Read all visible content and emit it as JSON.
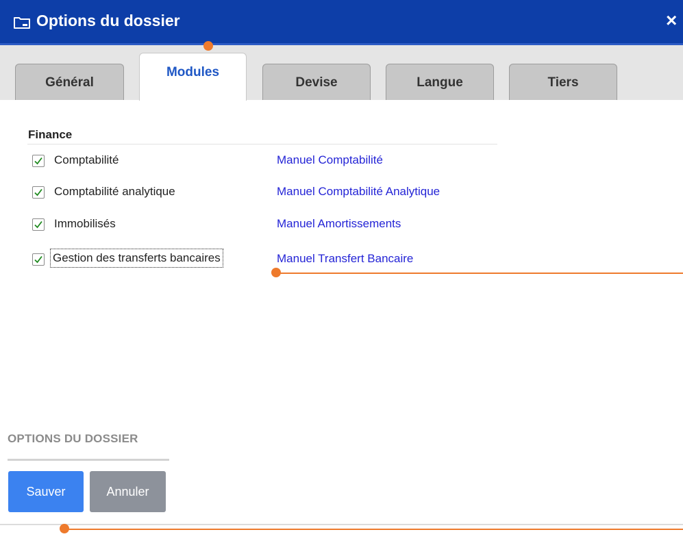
{
  "dialog": {
    "title": "Options du dossier",
    "title_icon": "folder-icon",
    "close_label": "×",
    "colors": {
      "titlebar": "#0d3ea8",
      "active_tab_text": "#1f57c5",
      "link": "#2424d6",
      "save_button": "#3b82f0",
      "cancel_button": "#8d929b",
      "annotation": "#ee7a2c"
    }
  },
  "tabs": [
    {
      "label": "Général",
      "active": false
    },
    {
      "label": "Modules",
      "active": true
    },
    {
      "label": "Devise",
      "active": false
    },
    {
      "label": "Langue",
      "active": false
    },
    {
      "label": "Tiers",
      "active": false
    }
  ],
  "section": {
    "title": "Finance",
    "modules": [
      {
        "label": "Comptabilité",
        "checked": true,
        "manual": "Manuel Comptabilité"
      },
      {
        "label": "Comptabilité analytique",
        "checked": true,
        "manual": "Manuel Comptabilité Analytique"
      },
      {
        "label": "Immobilisés",
        "checked": true,
        "manual": "Manuel Amortissements"
      },
      {
        "label": "Gestion des transferts bancaires",
        "checked": true,
        "manual": "Manuel Transfert Bancaire",
        "focused": true
      }
    ]
  },
  "footer": {
    "title": "OPTIONS DU DOSSIER",
    "save_label": "Sauver",
    "cancel_label": "Annuler"
  }
}
